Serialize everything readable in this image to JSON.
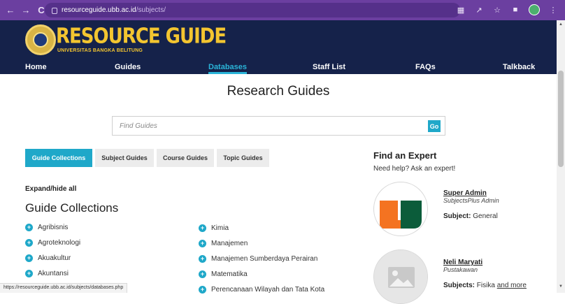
{
  "browser": {
    "url_host": "resourceguide.ubb.ac.id",
    "url_path": "/subjects/"
  },
  "header": {
    "logo_title": "RESOURCE GUIDE",
    "logo_subtitle": "UNIVERSITAS BANGKA BELITUNG",
    "nav": [
      "Home",
      "Guides",
      "Databases",
      "Staff List",
      "FAQs",
      "Talkback"
    ],
    "active_nav": "Databases"
  },
  "main": {
    "title": "Research Guides",
    "search": {
      "placeholder": "Find Guides",
      "button": "Go"
    },
    "tabs": [
      "Guide Collections",
      "Subject Guides",
      "Course Guides",
      "Topic Guides"
    ],
    "active_tab": "Guide Collections",
    "expand_label": "Expand/hide all",
    "section_title": "Guide Collections",
    "left_guides": [
      "Agribisnis",
      "Agroteknologi",
      "Akuakultur",
      "Akuntansi"
    ],
    "right_guides": [
      "Kimia",
      "Manajemen",
      "Manajemen Sumberdaya Perairan",
      "Matematika",
      "Perencanaan Wilayah dan Tata Kota"
    ]
  },
  "experts": {
    "title": "Find an Expert",
    "subtitle": "Need help? Ask an expert!",
    "people": [
      {
        "name": "Super Admin",
        "role": "SubjectsPlus Admin",
        "subject_label": "Subject:",
        "subject": "General",
        "more": ""
      },
      {
        "name": "Neli Maryati",
        "role": "Pustakawan",
        "subject_label": "Subjects:",
        "subject": "Fisika",
        "more": "and more"
      }
    ]
  },
  "status_bar": {
    "text": "https://resourceguide.ubb.ac.id/subjects/databases.php"
  },
  "colors": {
    "browser_frame": "#6b3fa0",
    "header_bg": "#15224a",
    "logo_gold": "#f3c530",
    "accent": "#1fa8c9"
  }
}
